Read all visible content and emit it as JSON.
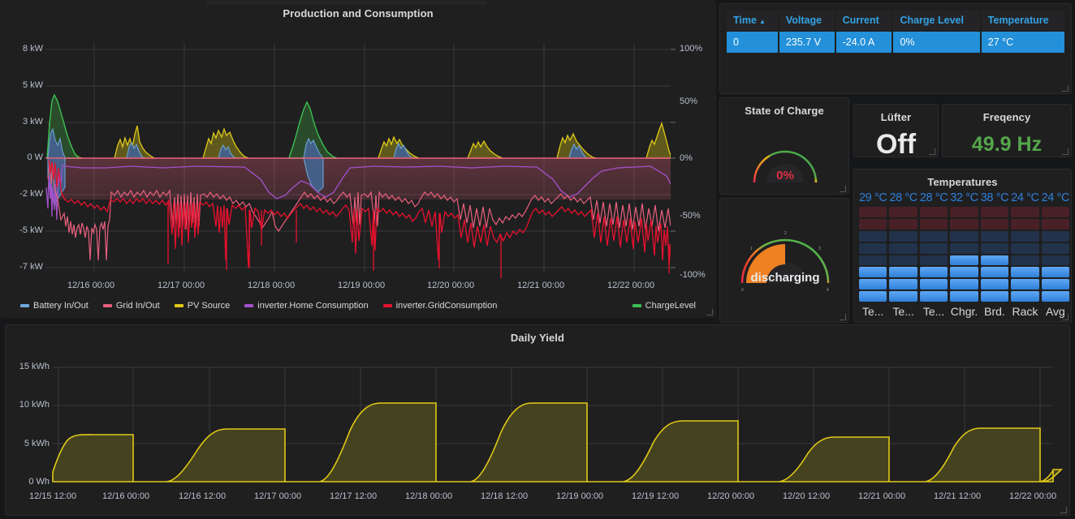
{
  "theme": {
    "panel_bg": "#1f1f20",
    "page_bg": "#161719",
    "text": "#d8d9da",
    "blue": "#2390d9",
    "green": "#56a64b",
    "red": "#e02f44",
    "orange": "#ef8123",
    "yellow": "#e0b400"
  },
  "panels": {
    "main": {
      "title": "Production and Consumption",
      "legend": [
        {
          "label": "Battery In/Out",
          "color": "#6fa8dc"
        },
        {
          "label": "Grid In/Out",
          "color": "#e8607b"
        },
        {
          "label": "PV Source",
          "color": "#e0c918"
        },
        {
          "label": "inverter.Home Consumption",
          "color": "#a352cc"
        },
        {
          "label": "inverter.GridConsumption",
          "color": "#e8112d"
        }
      ],
      "legend_right": [
        {
          "label": "ChargeLevel",
          "color": "#3bbf52"
        }
      ]
    },
    "table": {
      "columns": [
        "Time",
        "Voltage",
        "Current",
        "Charge Level",
        "Temperature"
      ],
      "sort_column": "Time",
      "sort_direction": "asc",
      "sort_caret": "▲",
      "rows": [
        [
          "0",
          "235.7 V",
          "-24.0 A",
          "0%",
          "27 °C"
        ]
      ]
    },
    "state_of_charge": {
      "title": "State of Charge",
      "value": "0%",
      "value_color": "#e02f44",
      "percent": 0
    },
    "luefter": {
      "title": "Lüfter",
      "value": "Off"
    },
    "frequency": {
      "title": "Freqency",
      "value": "49.9 Hz",
      "value_color": "#56a64b"
    },
    "discharging": {
      "title": "",
      "value": "discharging",
      "percent": 50,
      "tick_labels": [
        "0",
        "1",
        "2",
        "3",
        "4"
      ]
    },
    "temperatures": {
      "title": "Temperatures",
      "columns": [
        {
          "label": "Te...",
          "value": "29 °C",
          "filled": 3
        },
        {
          "label": "Te...",
          "value": "28 °C",
          "filled": 3
        },
        {
          "label": "Te...",
          "value": "28 °C",
          "filled": 3
        },
        {
          "label": "Chgr.",
          "value": "32 °C",
          "filled": 4
        },
        {
          "label": "Brd.",
          "value": "38 °C",
          "filled": 4
        },
        {
          "label": "Rack",
          "value": "24 °C",
          "filled": 3
        },
        {
          "label": "Avg",
          "value": "24 °C",
          "filled": 3
        }
      ],
      "total_cells": 8,
      "fill_color": "#3c93f0",
      "empty_cold_color": "#22324a",
      "empty_hot_color": "#4a2027",
      "hot_rows": 2
    },
    "yield": {
      "title": "Daily Yield"
    }
  },
  "chart_data": [
    {
      "type": "line",
      "id": "production_and_consumption",
      "title": "Production and Consumption",
      "xlabel": "",
      "ylabel": "",
      "grid": true,
      "legend_position": "bottom",
      "x_ticks": [
        "12/16 00:00",
        "12/17 00:00",
        "12/18 00:00",
        "12/19 00:00",
        "12/20 00:00",
        "12/21 00:00",
        "12/22 00:00"
      ],
      "y_left_ticks": [
        "8 kW",
        "5 kW",
        "3 kW",
        "0 W",
        "-2 kW",
        "-5 kW",
        "-7 kW"
      ],
      "y_left_values": [
        8000,
        5000,
        3000,
        0,
        -2000,
        -5000,
        -7000
      ],
      "y_right_ticks": [
        "100%",
        "50%",
        "0%",
        "-50%",
        "-100%"
      ],
      "y_right_values": [
        100,
        50,
        0,
        -50,
        -100
      ],
      "ylim": [
        -7800,
        8800
      ],
      "y2lim": [
        -110,
        112
      ],
      "series": [
        {
          "name": "Battery In/Out",
          "color": "#6fa8dc",
          "unit": "kW",
          "peak_values": [
            2.1,
            1.2,
            1.6,
            2.2,
            1.4,
            1.1,
            0.9
          ],
          "trough_values": [
            -2.4,
            -1.3,
            -1.4,
            -1.8,
            -1.1,
            -1.0,
            -1.2
          ]
        },
        {
          "name": "Grid In/Out",
          "color": "#e8607b",
          "unit": "kW",
          "baseline": -1.5,
          "min": -5.4,
          "max": 0.2
        },
        {
          "name": "PV Source",
          "color": "#e0c918",
          "unit": "kW",
          "daily_peaks": [
            3.4,
            2.6,
            3.1,
            3.9,
            2.4,
            2.6,
            2.0
          ]
        },
        {
          "name": "inverter.Home Consumption",
          "color": "#a352cc",
          "unit": "kW",
          "min": -2.5,
          "max": 0.1
        },
        {
          "name": "inverter.GridConsumption",
          "color": "#e8112d",
          "unit": "kW",
          "min": -7.2,
          "max": 0.1
        },
        {
          "name": "ChargeLevel",
          "color": "#3bbf52",
          "unit": "%",
          "daily_peaks": [
            52,
            0,
            0,
            45,
            0,
            0,
            0
          ]
        }
      ]
    },
    {
      "type": "area",
      "id": "daily_yield",
      "title": "Daily Yield",
      "xlabel": "",
      "ylabel": "",
      "grid": true,
      "legend_position": "none",
      "x_ticks": [
        "12/15 12:00",
        "12/16 00:00",
        "12/16 12:00",
        "12/17 00:00",
        "12/17 12:00",
        "12/18 00:00",
        "12/18 12:00",
        "12/19 00:00",
        "12/19 12:00",
        "12/20 00:00",
        "12/20 12:00",
        "12/21 00:00",
        "12/21 12:00",
        "12/22 00:00"
      ],
      "y_ticks": [
        "15 kWh",
        "10 kWh",
        "5 kWh",
        "0 Wh"
      ],
      "y_values": [
        15,
        10,
        5,
        0
      ],
      "ylim": [
        0,
        15.6
      ],
      "series": [
        {
          "name": "Daily Yield",
          "color": "#e0c918",
          "fill": "#45431f",
          "daily_totals_kwh": [
            6.2,
            6.9,
            10.3,
            10.3,
            8.0,
            5.8,
            7.0,
            0.9
          ]
        }
      ]
    }
  ]
}
